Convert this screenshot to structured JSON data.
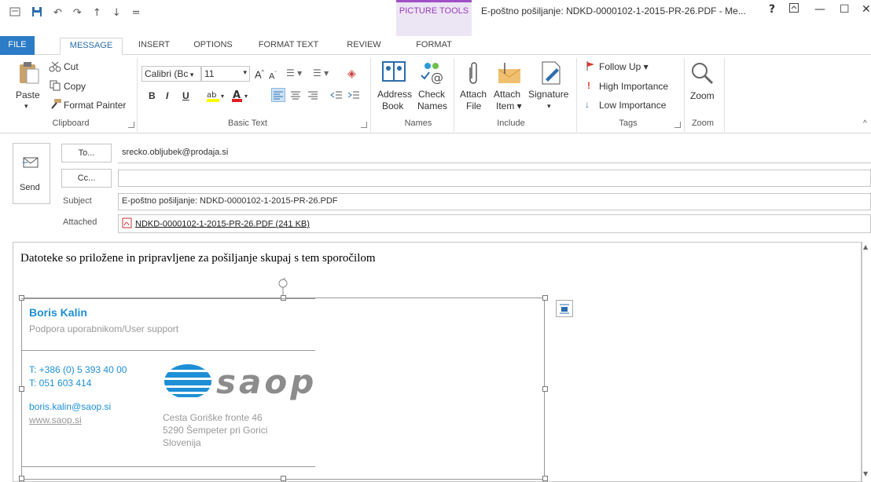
{
  "window": {
    "title": "E-poštno pošiljanje: NDKD-0000102-1-2015-PR-26.PDF - Me...",
    "context_tab_group": "PICTURE TOOLS",
    "controls": {
      "help": "?",
      "restore_ribbon": "⊡",
      "minimize": "—",
      "maximize": "☐",
      "close": "✕"
    }
  },
  "qat": {
    "menu": "☰",
    "save": "💾",
    "undo": "↶",
    "redo": "↷",
    "up": "↑",
    "down": "↓",
    "customize": "="
  },
  "tabs": [
    {
      "label": "FILE"
    },
    {
      "label": "MESSAGE"
    },
    {
      "label": "INSERT"
    },
    {
      "label": "OPTIONS"
    },
    {
      "label": "FORMAT TEXT"
    },
    {
      "label": "REVIEW"
    },
    {
      "label": "FORMAT"
    }
  ],
  "ribbon": {
    "clipboard": {
      "label": "Clipboard",
      "paste": "Paste",
      "cut": "Cut",
      "copy": "Copy",
      "format_painter": "Format Painter"
    },
    "basic_text": {
      "label": "Basic Text",
      "font": "Calibri (Bc",
      "size": "11",
      "bold": "B",
      "italic": "I",
      "underline": "U"
    },
    "names": {
      "label": "Names",
      "address_book_1": "Address",
      "address_book_2": "Book",
      "check_names_1": "Check",
      "check_names_2": "Names"
    },
    "include": {
      "label": "Include",
      "attach_file_1": "Attach",
      "attach_file_2": "File",
      "attach_item_1": "Attach",
      "attach_item_2": "Item ▾",
      "signature": "Signature",
      "signature_arrow": "▾"
    },
    "tags": {
      "label": "Tags",
      "follow_up": "Follow Up ▾",
      "high_importance": "High Importance",
      "low_importance": "Low Importance"
    },
    "zoom": {
      "label": "Zoom",
      "zoom": "Zoom"
    }
  },
  "compose": {
    "send": "Send",
    "to_button": "To...",
    "cc_button": "Cc...",
    "subject_label": "Subject",
    "attached_label": "Attached",
    "to_value": "srecko.obljubek@prodaja.si",
    "cc_value": "",
    "subject_value": "E-poštno pošiljanje: NDKD-0000102-1-2015-PR-26.PDF",
    "attachment": "NDKD-0000102-1-2015-PR-26.PDF (241 KB)"
  },
  "body": {
    "text": "Datoteke so priložene in pripravljene za pošiljanje skupaj s tem sporočilom"
  },
  "signature": {
    "name": "Boris Kalin",
    "role": "Podpora uporabnikom/User support",
    "phone1": "T: +386 (0) 5 393 40 00",
    "phone2": "T: 051 603 414",
    "email": "boris.kalin@saop.si",
    "web": "www.saop.si",
    "logo_text": "saop",
    "address1": "Cesta Goriške fronte 46",
    "address2": "5290 Šempeter pri Gorici",
    "address3": "Slovenija"
  },
  "colors": {
    "accent": "#2b7bc6",
    "picture_tools": "#a04fc6",
    "signature_blue": "#1e8fd6"
  }
}
